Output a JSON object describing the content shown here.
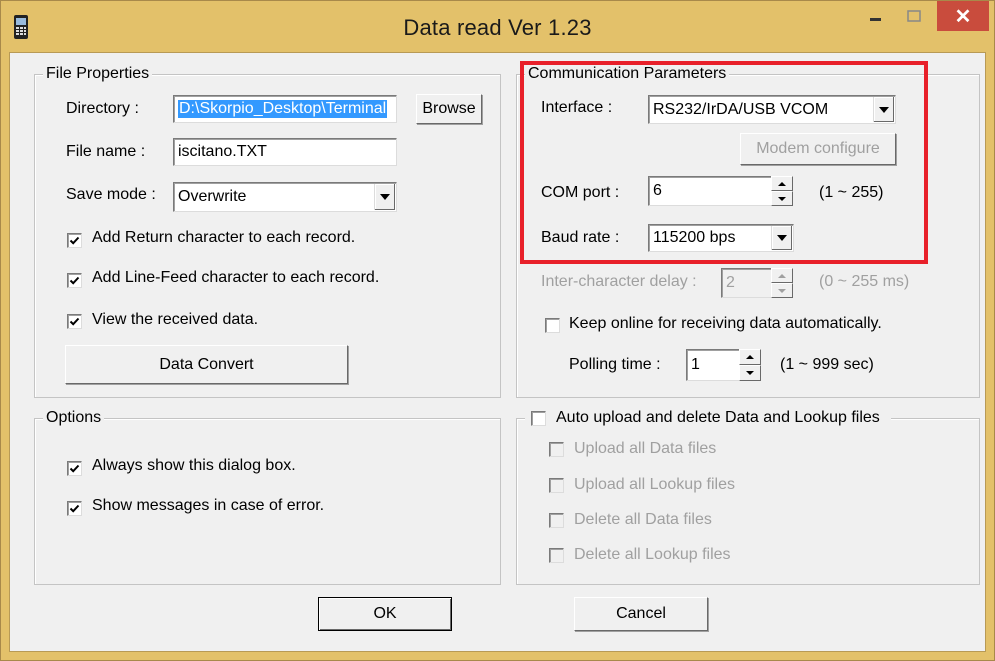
{
  "window": {
    "title": "Data read  Ver 1.23",
    "icons": {
      "app": "handheld-terminal-icon",
      "minimize": "minimize-icon",
      "maximize": "maximize-icon",
      "close": "close-icon"
    },
    "close_glyph": "✕",
    "colors": {
      "title_bar": "#e3c16a",
      "close_button": "#c94c3d",
      "highlight_box": "#e8202a",
      "selection": "#3399ff"
    }
  },
  "file_properties": {
    "legend": "File Properties",
    "directory_label": "Directory :",
    "directory_value": "D:\\Skorpio_Desktop\\Terminal",
    "browse_button": "Browse",
    "filename_label": "File name :",
    "filename_value": "iscitano.TXT",
    "save_mode_label": "Save mode :",
    "save_mode_value": "Overwrite",
    "checkboxes": [
      {
        "label": "Add Return character to each record.",
        "checked": true
      },
      {
        "label": "Add Line-Feed character to each record.",
        "checked": true
      },
      {
        "label": "View the received data.",
        "checked": true
      }
    ],
    "data_convert_button": "Data Convert"
  },
  "options": {
    "legend": "Options",
    "checkboxes": [
      {
        "label": "Always show this dialog box.",
        "checked": true
      },
      {
        "label": "Show messages in case of error.",
        "checked": true
      }
    ]
  },
  "communication": {
    "legend": "Communication Parameters",
    "interface_label": "Interface :",
    "interface_value": "RS232/IrDA/USB VCOM",
    "modem_button": "Modem configure",
    "com_port_label": "COM port :",
    "com_port_value": "6",
    "com_port_range": "(1 ~ 255)",
    "baud_label": "Baud rate :",
    "baud_value": "115200 bps",
    "inter_char_label": "Inter-character delay :",
    "inter_char_value": "2",
    "inter_char_range": "(0 ~ 255 ms)",
    "keep_online_label": "Keep online for receiving data automatically.",
    "keep_online_checked": false,
    "polling_label": "Polling time :",
    "polling_value": "1",
    "polling_range": "(1 ~ 999 sec)"
  },
  "auto_upload": {
    "legend": "Auto upload and delete Data and Lookup files",
    "checked": false,
    "checkboxes": [
      {
        "label": "Upload all Data files",
        "checked": false,
        "enabled": false
      },
      {
        "label": "Upload all Lookup files",
        "checked": false,
        "enabled": false
      },
      {
        "label": "Delete all Data files",
        "checked": false,
        "enabled": false
      },
      {
        "label": "Delete all Lookup files",
        "checked": false,
        "enabled": false
      }
    ]
  },
  "footer": {
    "ok_button": "OK",
    "cancel_button": "Cancel"
  }
}
